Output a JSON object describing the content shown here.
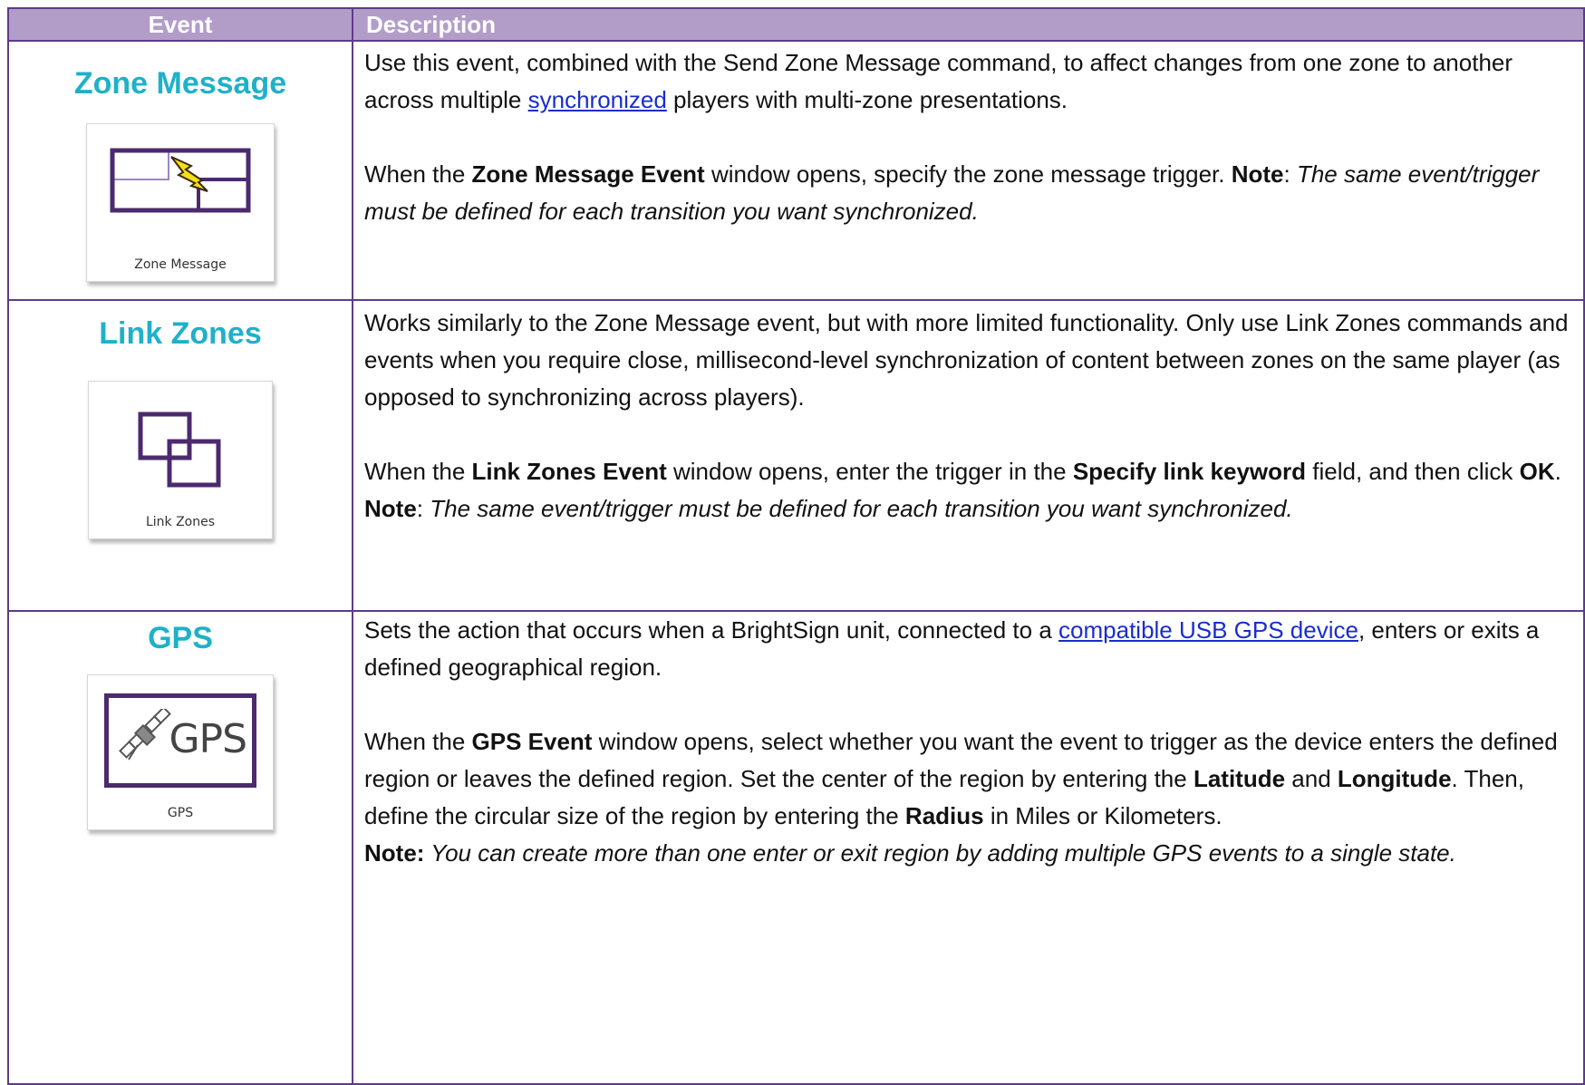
{
  "table": {
    "headers": {
      "event": "Event",
      "description": "Description"
    }
  },
  "rows": [
    {
      "title": "Zone Message",
      "icon_name": "zone-message-icon",
      "icon_caption": "Zone Message",
      "p1": {
        "t1": "Use this event, combined with the Send Zone Message command, to affect changes from one zone to another across multiple ",
        "link": "synchronized",
        "t2": " players with multi-zone presentations."
      },
      "p2": {
        "t1": "When the ",
        "b1": "Zone Message Event",
        "t2": " window opens, specify the zone message trigger. ",
        "note": "Note",
        "t3": ": ",
        "italic": "The same event/trigger must be defined for each transition you want synchronized."
      }
    },
    {
      "title": "Link Zones",
      "icon_name": "link-zones-icon",
      "icon_caption": "Link Zones",
      "p1": {
        "t1": "Works similarly to the Zone Message event, but with more limited functionality. Only use Link Zones commands and events when you require close, millisecond-level synchronization of content between zones on the same player (as opposed to synchronizing across players)."
      },
      "p2": {
        "t1": "When the ",
        "b1": "Link Zones Event",
        "t2": " window opens, enter the trigger in the ",
        "b2": "Specify link keyword",
        "t3": " field, and then click ",
        "b3": "OK",
        "t4": ". ",
        "note": "Note",
        "t5": ": ",
        "italic": "The same event/trigger must be defined for each transition you want synchronized."
      }
    },
    {
      "title": "GPS",
      "icon_name": "gps-satellite-icon",
      "icon_caption": "GPS",
      "icon_text": "GPS",
      "p1": {
        "t1": "Sets the action that occurs when a BrightSign unit, connected to a ",
        "link": "compatible USB GPS device",
        "t2": ", enters or exits a defined geographical region."
      },
      "p2": {
        "t1": "When the ",
        "b1": "GPS Event",
        "t2": " window opens, select whether you want the event to trigger as the device enters the defined region or leaves the defined region. Set the center of the region by entering the ",
        "b2": "Latitude",
        "t3": " and ",
        "b3": "Longitude",
        "t4": ". Then, define the circular size of the region by entering the ",
        "b4": "Radius",
        "t5": " in Miles or Kilometers."
      },
      "p3": {
        "note": "Note:",
        "italic": " You can create more than one enter or exit region by adding multiple GPS events to a single state."
      }
    }
  ],
  "colors": {
    "header_bg": "#b29dc9",
    "border": "#5e3a8a",
    "title": "#1fb1c8",
    "link": "#1a2dcc",
    "icon_purple": "#4b2a6e",
    "icon_lavender": "#9a88c6",
    "icon_yellow": "#f4de16"
  }
}
